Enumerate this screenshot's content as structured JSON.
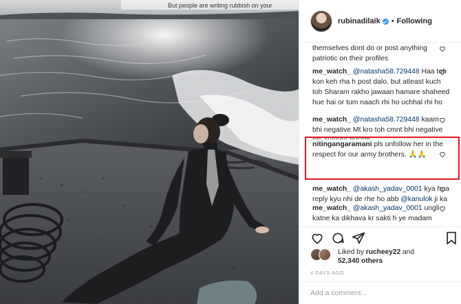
{
  "photo": {
    "overlay_caption": "But people are writing rubbish on your"
  },
  "header": {
    "username": "rubinadilaik",
    "separator": "•",
    "follow_state": "Following"
  },
  "comments": [
    {
      "user": "",
      "text": "themselves dont do or post anything patriotic on their profiles"
    },
    {
      "user": "me_watch_",
      "mention": "@natasha58.729448",
      "text": " Haa toh kon keh rha h post dalo. but atleast kuch toh Sharam rakho jawaan hamare shaheed hue hai or tum naach rhi ho uchhal rhi ho"
    },
    {
      "user": "me_watch_",
      "mention": "@natasha58.729448",
      "text": " kaam bhi negative Mt kro toh cmnt bhi negative nhi ayenge ma'am"
    },
    {
      "user": "nitingangaramani",
      "text": " pls unfollow her in the respect for our army brothers. 🙏🙏"
    },
    {
      "user": "me_watch_",
      "mention": "@akash_yadav_0001",
      "text": " kya hua reply kyu nhi de rhe ho abb",
      "mention2": "@kanulok",
      "text2": " ji ka"
    },
    {
      "user": "me_watch_",
      "mention": "@akash_yadav_0001",
      "text": " ungli katne ka dikhava kr sakti h ye madam"
    }
  ],
  "likes": {
    "prefix": "Liked by ",
    "first_user": "rucheey22",
    "middle": " and",
    "count": "52,340 others"
  },
  "timestamp": "4 DAYS AGO",
  "add_comment": {
    "placeholder": "Add a comment..."
  },
  "colors": {
    "highlight": "#e3141e",
    "verified": "#3897f0",
    "mention": "#003569"
  },
  "icons": [
    "heart-icon",
    "comment-icon",
    "share-icon",
    "bookmark-icon",
    "verified-badge-icon"
  ]
}
